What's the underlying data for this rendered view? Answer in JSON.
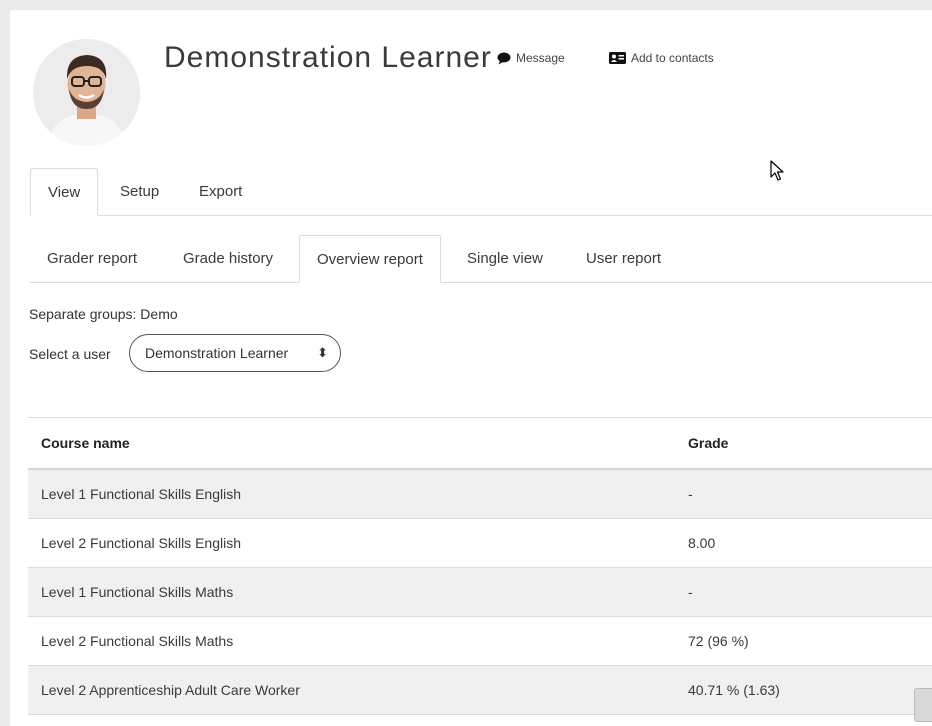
{
  "profile": {
    "name": "Demonstration Learner",
    "message_label": "Message",
    "add_contacts_label": "Add to contacts"
  },
  "primary_tabs": [
    {
      "label": "View",
      "active": true
    },
    {
      "label": "Setup",
      "active": false
    },
    {
      "label": "Export",
      "active": false
    }
  ],
  "report_tabs": [
    {
      "label": "Grader report",
      "active": false
    },
    {
      "label": "Grade history",
      "active": false
    },
    {
      "label": "Overview report",
      "active": true
    },
    {
      "label": "Single view",
      "active": false
    },
    {
      "label": "User report",
      "active": false
    }
  ],
  "filters": {
    "separate_groups_label": "Separate groups:",
    "separate_groups_value": "Demo",
    "select_user_label": "Select a user",
    "select_user_value": "Demonstration Learner"
  },
  "table": {
    "headers": [
      "Course name",
      "Grade"
    ],
    "rows": [
      [
        "Level 1 Functional Skills English",
        "-"
      ],
      [
        "Level 2 Functional Skills English",
        "8.00"
      ],
      [
        "Level 1 Functional Skills Maths",
        "-"
      ],
      [
        "Level 2 Functional Skills Maths",
        "72 (96 %)"
      ],
      [
        "Level 2 Apprenticeship Adult Care Worker",
        "40.71 % (1.63)"
      ]
    ]
  },
  "icons": {
    "message": "speech-bubble-icon",
    "contacts": "address-card-icon",
    "select_arrow": "updown-arrow-icon"
  }
}
